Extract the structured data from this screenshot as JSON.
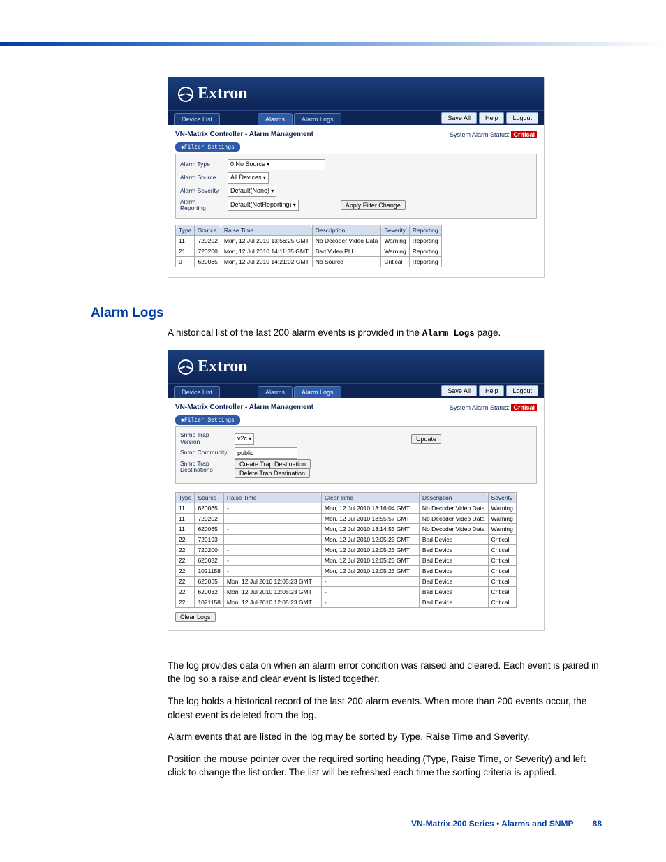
{
  "brand": "Extron",
  "screenshot1": {
    "tabs": {
      "device_list": "Device List",
      "alarms": "Alarms",
      "alarm_logs": "Alarm Logs"
    },
    "top_buttons": {
      "save_all": "Save All",
      "help": "Help",
      "logout": "Logout"
    },
    "page_title": "VN-Matrix Controller - Alarm Management",
    "status_label": "System Alarm Status:",
    "status_value": "Critical",
    "filter_toggle": "◆Filter Settings",
    "filters": {
      "type_label": "Alarm Type",
      "type_value": "0 No Source",
      "source_label": "Alarm Source",
      "source_value": "All Devices",
      "severity_label": "Alarm Severity",
      "severity_value": "Default(None)",
      "reporting_label": "Alarm Reporting",
      "reporting_value": "Default(NotReporting)",
      "apply": "Apply Filter Change"
    },
    "columns": {
      "type": "Type",
      "source": "Source",
      "raise": "Raise Time",
      "desc": "Description",
      "sev": "Severity",
      "rep": "Reporting"
    },
    "rows": [
      {
        "type": "11",
        "source": "720202",
        "raise": "Mon, 12 Jul 2010 13:56:25 GMT",
        "desc": "No Decoder Video Data",
        "sev": "Warning",
        "rep": "Reporting"
      },
      {
        "type": "21",
        "source": "720200",
        "raise": "Mon, 12 Jul 2010 14:11:35 GMT",
        "desc": "Bad Video PLL",
        "sev": "Warning",
        "rep": "Reporting"
      },
      {
        "type": "0",
        "source": "620065",
        "raise": "Mon, 12 Jul 2010 14:21:02 GMT",
        "desc": "No Source",
        "sev": "Critical",
        "rep": "Reporting"
      }
    ]
  },
  "section": {
    "heading": "Alarm Logs",
    "intro_a": "A historical list of the last 200 alarm events is provided in the ",
    "intro_b": "Alarm Logs",
    "intro_c": " page."
  },
  "screenshot2": {
    "tabs": {
      "device_list": "Device List",
      "alarms": "Alarms",
      "alarm_logs": "Alarm Logs"
    },
    "top_buttons": {
      "save_all": "Save All",
      "help": "Help",
      "logout": "Logout"
    },
    "page_title": "VN-Matrix Controller - Alarm Management",
    "status_label": "System Alarm Status:",
    "status_value": "Critical",
    "filter_toggle": "◆Filter Settings",
    "snmp": {
      "version_label": "Snmp Trap Version",
      "version_value": "v2c",
      "community_label": "Snmp Community",
      "community_value": "public",
      "dest_label": "Snmp Trap Destinations",
      "create": "Create Trap Destination",
      "delete": "Delete Trap Destination",
      "update": "Update"
    },
    "columns": {
      "type": "Type",
      "source": "Source",
      "raise": "Raise Time",
      "clear": "Clear Time",
      "desc": "Description",
      "sev": "Severity"
    },
    "rows": [
      {
        "type": "11",
        "source": "620065",
        "raise": "-",
        "clear": "Mon, 12 Jul 2010 13:16:04 GMT",
        "desc": "No Decoder Video Data",
        "sev": "Warning"
      },
      {
        "type": "11",
        "source": "720202",
        "raise": "-",
        "clear": "Mon, 12 Jul 2010 13:55:57 GMT",
        "desc": "No Decoder Video Data",
        "sev": "Warning"
      },
      {
        "type": "11",
        "source": "620065",
        "raise": "-",
        "clear": "Mon, 12 Jul 2010 13:14:53 GMT",
        "desc": "No Decoder Video Data",
        "sev": "Warning"
      },
      {
        "type": "22",
        "source": "720193",
        "raise": "-",
        "clear": "Mon, 12 Jul 2010 12:05:23 GMT",
        "desc": "Bad Device",
        "sev": "Critical"
      },
      {
        "type": "22",
        "source": "720200",
        "raise": "-",
        "clear": "Mon, 12 Jul 2010 12:05:23 GMT",
        "desc": "Bad Device",
        "sev": "Critical"
      },
      {
        "type": "22",
        "source": "620032",
        "raise": "-",
        "clear": "Mon, 12 Jul 2010 12:05:23 GMT",
        "desc": "Bad Device",
        "sev": "Critical"
      },
      {
        "type": "22",
        "source": "1021158",
        "raise": "-",
        "clear": "Mon, 12 Jul 2010 12:05:23 GMT",
        "desc": "Bad Device",
        "sev": "Critical"
      },
      {
        "type": "22",
        "source": "620065",
        "raise": "Mon, 12 Jul 2010 12:05:23 GMT",
        "clear": "-",
        "desc": "Bad Device",
        "sev": "Critical"
      },
      {
        "type": "22",
        "source": "620032",
        "raise": "Mon, 12 Jul 2010 12:05:23 GMT",
        "clear": "-",
        "desc": "Bad Device",
        "sev": "Critical"
      },
      {
        "type": "22",
        "source": "1021158",
        "raise": "Mon, 12 Jul 2010 12:05:23 GMT",
        "clear": "-",
        "desc": "Bad Device",
        "sev": "Critical"
      }
    ],
    "clear_logs": "Clear Logs"
  },
  "paragraphs": {
    "p1": "The log provides data on when an alarm error condition was raised and cleared. Each event is paired in the log so a raise and clear event is listed together.",
    "p2": "The log holds a historical record of the last 200 alarm events. When more than 200 events occur, the oldest event is deleted from the log.",
    "p3": "Alarm events that are listed in the log may be sorted by Type, Raise Time and Severity.",
    "p4": "Position the mouse pointer over the required sorting heading (Type, Raise Time, or Severity) and left click to change the list order. The list will be refreshed each time the sorting criteria is applied."
  },
  "footer": {
    "text": "VN-Matrix 200 Series  •  Alarms and SNMP",
    "page": "88"
  }
}
